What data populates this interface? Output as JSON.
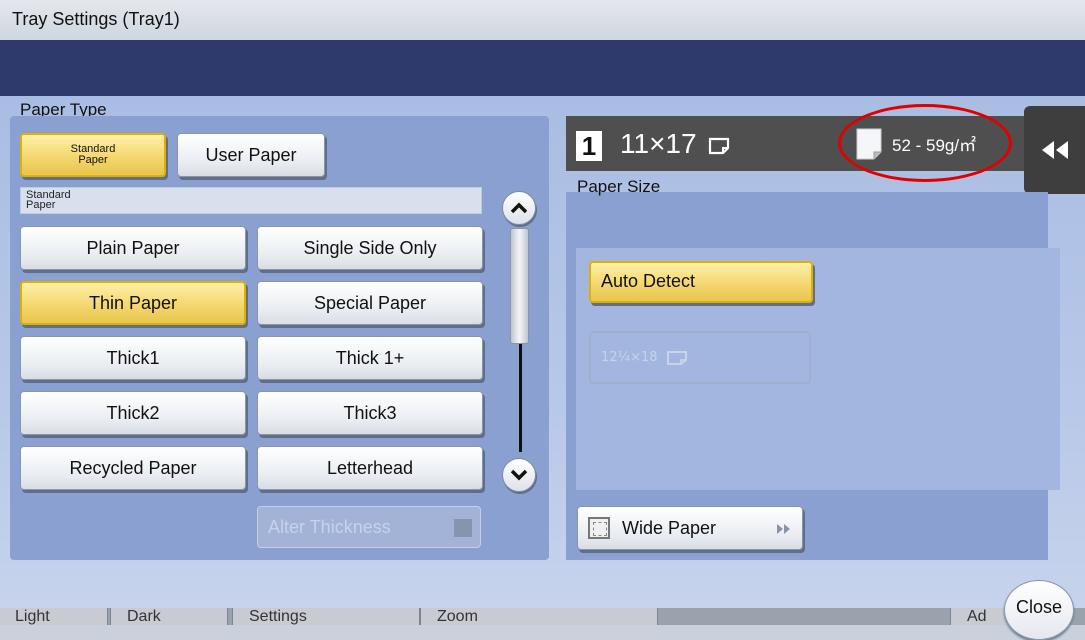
{
  "window": {
    "title": "Tray Settings (Tray1)"
  },
  "paper_type": {
    "label": "Paper Type",
    "tabs": {
      "standard": "Standard\nPaper",
      "user": "User Paper"
    },
    "current_category": "Standard\nPaper",
    "options": [
      {
        "label": "Plain Paper",
        "selected": false
      },
      {
        "label": "Single Side Only",
        "selected": false
      },
      {
        "label": "Thin Paper",
        "selected": true
      },
      {
        "label": "Special Paper",
        "selected": false
      },
      {
        "label": "Thick1",
        "selected": false
      },
      {
        "label": "Thick 1+",
        "selected": false
      },
      {
        "label": "Thick2",
        "selected": false
      },
      {
        "label": "Thick3",
        "selected": false
      },
      {
        "label": "Recycled Paper",
        "selected": false
      },
      {
        "label": "Letterhead",
        "selected": false
      }
    ],
    "alter_thickness": "Alter Thickness"
  },
  "status": {
    "tray": "1",
    "size": "11×17",
    "weight": "52 - 59g/㎡"
  },
  "paper_size": {
    "label": "Paper Size",
    "auto_detect": "Auto Detect",
    "custom_size": "12¼×18",
    "wide_paper": "Wide Paper"
  },
  "footer": {
    "close": "Close",
    "hidden_buttons": [
      "Light",
      "Dark",
      "Settings",
      "Zoom",
      "Ad"
    ]
  },
  "colors": {
    "accent_yellow": "#f3d56a",
    "highlight_red": "#e00000",
    "header_navy": "#2e3a6c"
  }
}
